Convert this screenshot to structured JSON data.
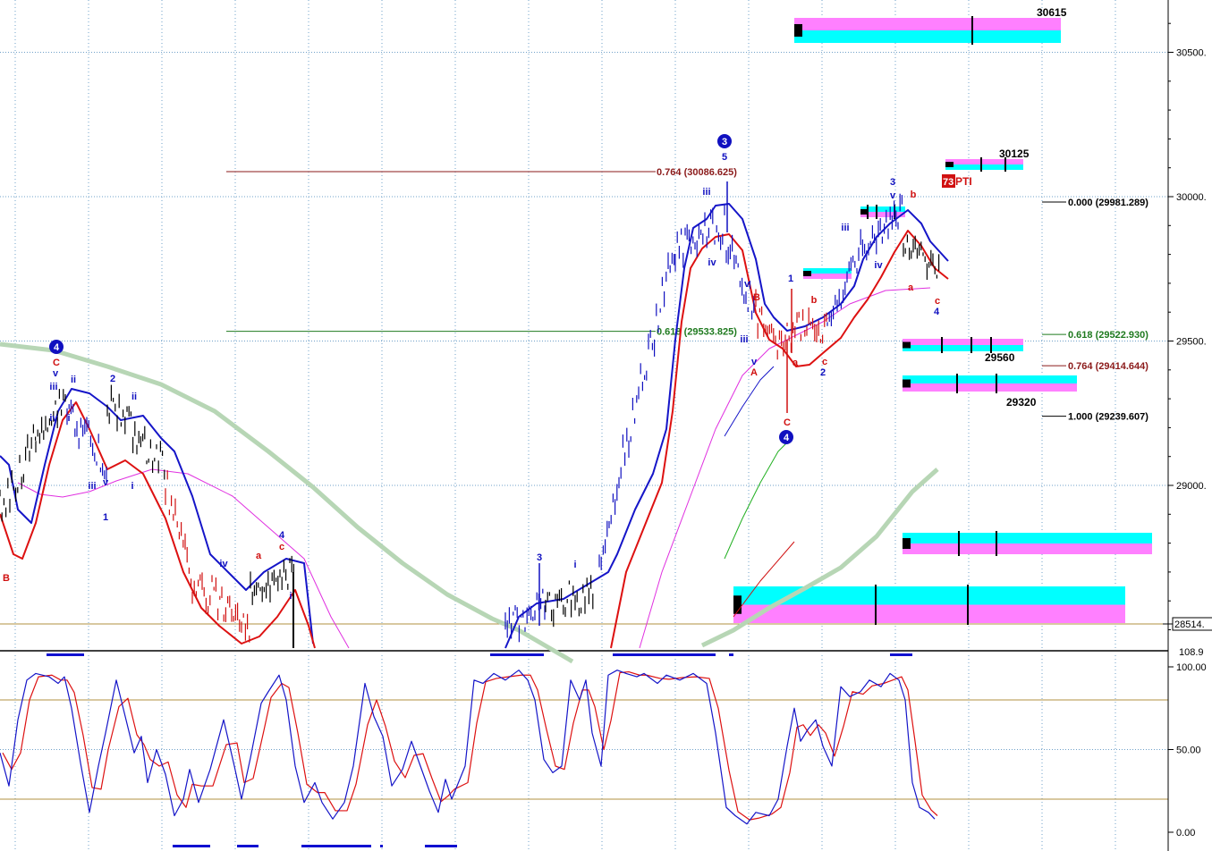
{
  "chart_data": [
    {
      "type": "line",
      "title": "",
      "ylim": [
        28400,
        30680
      ],
      "y_ticks": [
        "30500.",
        "30000.",
        "29500.",
        "29000."
      ],
      "current_price_label": "28514.",
      "fib_levels": [
        {
          "label": "0.764 (30086.625)",
          "value": 30086.625,
          "color": "#8b1a1a"
        },
        {
          "label": "0.618 (29533.825)",
          "value": 29533.825,
          "color": "#1f7a1f"
        },
        {
          "label": "0.000 (29981.289)",
          "value": 29981.289,
          "color": "#000000"
        },
        {
          "label": "0.618 (29522.930)",
          "value": 29522.93,
          "color": "#1f7a1f"
        },
        {
          "label": "0.764 (29414.644)",
          "value": 29414.644,
          "color": "#8b1a1a"
        },
        {
          "label": "1.000 (29239.607)",
          "value": 29239.607,
          "color": "#000000"
        }
      ],
      "target_labels": [
        "30615",
        "30125",
        "29560",
        "29320"
      ],
      "pti_label": "73",
      "pti_text": "PTI",
      "wave_labels": [
        {
          "text": "4",
          "color": "#1010c0",
          "circled": true
        },
        {
          "text": "C",
          "color": "#d01010"
        },
        {
          "text": "v",
          "color": "#1010c0"
        },
        {
          "text": "iii",
          "color": "#1010c0"
        },
        {
          "text": "ii",
          "color": "#1010c0"
        },
        {
          "text": "iv",
          "color": "#1010c0"
        },
        {
          "text": "i",
          "color": "#1010c0"
        },
        {
          "text": "2",
          "color": "#1010c0"
        },
        {
          "text": "ii",
          "color": "#1010c0"
        },
        {
          "text": "iii",
          "color": "#1010c0"
        },
        {
          "text": "v",
          "color": "#1010c0"
        },
        {
          "text": "1",
          "color": "#1010c0"
        },
        {
          "text": "i",
          "color": "#1010c0"
        },
        {
          "text": "B",
          "color": "#d01010"
        },
        {
          "text": "iv",
          "color": "#1010c0"
        },
        {
          "text": "a",
          "color": "#d01010"
        },
        {
          "text": "4",
          "color": "#1010c0"
        },
        {
          "text": "c",
          "color": "#d01010"
        },
        {
          "text": "i",
          "color": "#1010c0"
        },
        {
          "text": "3",
          "color": "#1010c0"
        },
        {
          "text": "i",
          "color": "#1010c0"
        },
        {
          "text": "3",
          "color": "#1010c0",
          "circled": true
        },
        {
          "text": "5",
          "color": "#1010c0"
        },
        {
          "text": "iii",
          "color": "#1010c0"
        },
        {
          "text": "iv",
          "color": "#1010c0"
        },
        {
          "text": "v",
          "color": "#1010c0"
        },
        {
          "text": "iii",
          "color": "#1010c0"
        },
        {
          "text": "v",
          "color": "#1010c0"
        },
        {
          "text": "A",
          "color": "#d01010"
        },
        {
          "text": "B",
          "color": "#d01010"
        },
        {
          "text": "a",
          "color": "#d01010"
        },
        {
          "text": "C",
          "color": "#d01010"
        },
        {
          "text": "4",
          "color": "#1010c0",
          "circled": true
        },
        {
          "text": "1",
          "color": "#1010c0"
        },
        {
          "text": "b",
          "color": "#d01010"
        },
        {
          "text": "c",
          "color": "#d01010"
        },
        {
          "text": "2",
          "color": "#1010c0"
        },
        {
          "text": "iii",
          "color": "#1010c0"
        },
        {
          "text": "iv",
          "color": "#1010c0"
        },
        {
          "text": "3",
          "color": "#1010c0"
        },
        {
          "text": "v",
          "color": "#1010c0"
        },
        {
          "text": "b",
          "color": "#d01010"
        },
        {
          "text": "a",
          "color": "#d01010"
        },
        {
          "text": "c",
          "color": "#d01010"
        },
        {
          "text": "4",
          "color": "#1010c0"
        }
      ],
      "colors": {
        "price_up": "#1010c0",
        "price_down": "#d01010",
        "upper_band": "#1515c8",
        "lower_band": "#dd1111",
        "slow_ma": "#b7d6b5",
        "mid_ma": "#e030e0",
        "target_cyan": "#00ffff",
        "target_magenta": "#ff80ff",
        "grid": "#6fa0c8",
        "support": "#b09040"
      }
    },
    {
      "type": "line",
      "title": "",
      "ylim": [
        0,
        100
      ],
      "y_ticks": [
        "100.00",
        "50.00",
        "0.00"
      ],
      "top_partial_label": "108.9",
      "overbought": 80,
      "oversold": 20,
      "series": [
        {
          "color": "#1515c8"
        },
        {
          "color": "#dd1111"
        }
      ]
    }
  ]
}
